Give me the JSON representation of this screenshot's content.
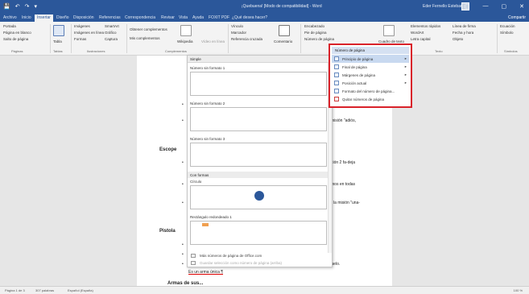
{
  "titlebar": {
    "qat": [
      "💾",
      "↶",
      "↷",
      "▾"
    ],
    "title": "¡Quebuena! [Modo de compatibilidad] - Word",
    "user": "Eder Fernello Esteban",
    "win_buttons": [
      "▢",
      "—",
      "▢",
      "✕"
    ]
  },
  "tabs": [
    "Archivo",
    "Inicio",
    "Insertar",
    "Diseño",
    "Disposición",
    "Referencias",
    "Correspondencia",
    "Revisar",
    "Vista",
    "Ayuda",
    "FOXIT PDF",
    "¿Qué desea hacer?"
  ],
  "share_label": "Compartir",
  "ribbon": {
    "paginas": [
      "Portada",
      "Página en blanco",
      "Salto de página"
    ],
    "paginas_label": "Páginas",
    "tabla": "Tabla",
    "tablas_label": "Tablas",
    "ilus": [
      "Imágenes",
      "Imágenes en línea",
      "Formas"
    ],
    "ilus2": [
      "SmartArt",
      "Gráfico",
      "Captura"
    ],
    "ilus_label": "Ilustraciones",
    "comp": [
      "Obtener complementos",
      "Mis complementos"
    ],
    "wikipedia": "Wikipedia",
    "video": "Vídeo en línea",
    "comp_label": "Complementos",
    "links": [
      "Vínculo",
      "Marcador",
      "Referencia cruzada"
    ],
    "comentario": "Comentario",
    "header": [
      "Encabezado",
      "Pie de página",
      "Número de página"
    ],
    "cuadro": "Cuadro de texto",
    "texto": [
      "Elementos rápidos",
      "WordArt",
      "Letra capital"
    ],
    "texto2": [
      "Línea de firma",
      "Fecha y hora",
      "Objeto"
    ],
    "texto_label": "Texto",
    "simbolos": [
      "Ecuación",
      "Símbolo"
    ],
    "simbolos_label": "Símbolos"
  },
  "gallery": {
    "header": "Simple",
    "items": [
      "Número sin formato 1",
      "Número sin formato 2",
      "Número sin formato 3"
    ],
    "section": "Con formas",
    "items2": [
      "Círculo",
      "Rectángulo redondeado 1"
    ],
    "footer": [
      "Más números de página de Office.com",
      "Guardar selección como número de página (arriba)"
    ]
  },
  "menu": {
    "header": "Número de página",
    "items": [
      "Principio de página",
      "Final de página",
      "Márgenes de página",
      "Posición actual",
      "Formato del número de página...",
      "Quitar números de página"
    ]
  },
  "doc": {
    "lines": [
      "misión \"adiós,",
      "Escope",
      "ción 2 fa-deja",
      "mos en todas",
      "r la misión \"una-",
      "Pistola",
      "final del duelo.",
      "Es un arma única ¶",
      "Armas de sus..."
    ],
    "bullet": "•"
  },
  "status": {
    "left": [
      "Página 1 de 3",
      "307 palabras",
      "Español (España)"
    ],
    "zoom": "100 %"
  }
}
